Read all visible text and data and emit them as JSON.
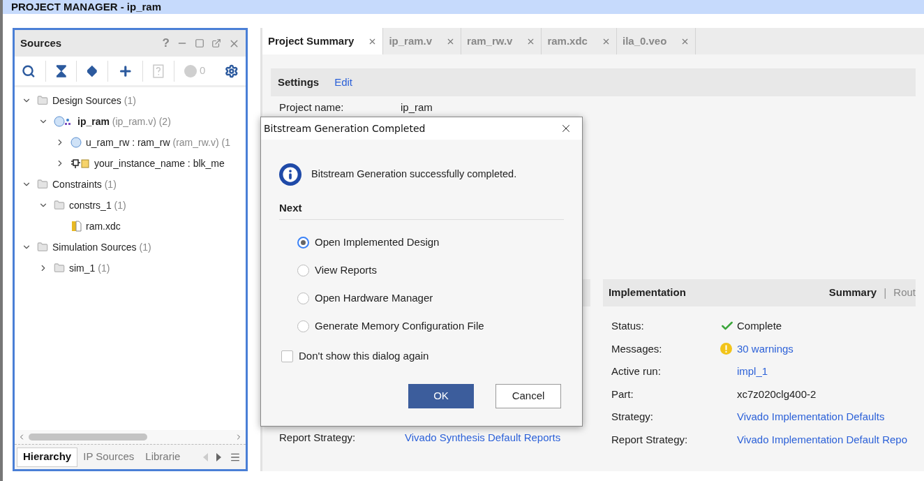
{
  "title_bar": {
    "title": "PROJECT MANAGER - ip_ram"
  },
  "sources": {
    "title": "Sources",
    "help": "?",
    "badge_count": "0",
    "tree": [
      {
        "label": "Design Sources",
        "detail": "(1)",
        "kind": "folder",
        "expanded": true,
        "children": [
          {
            "label": "**ip_ram**",
            "detail": "(ip_ram.v) (2)",
            "kind": "top",
            "expanded": true,
            "children": [
              {
                "label": "u_ram_rw : ram_rw",
                "detail": "(ram_rw.v) (1",
                "kind": "verilog",
                "expanded": false
              },
              {
                "label": "your_instance_name : blk_me",
                "kind": "ip",
                "expanded": false
              }
            ]
          }
        ]
      },
      {
        "label": "Constraints",
        "detail": "(1)",
        "kind": "folder",
        "expanded": true,
        "children": [
          {
            "label": "constrs_1",
            "detail": "(1)",
            "kind": "folder",
            "expanded": true,
            "children": [
              {
                "label": "ram.xdc",
                "kind": "xdc"
              }
            ]
          }
        ]
      },
      {
        "label": "Simulation Sources",
        "detail": "(1)",
        "kind": "folder",
        "expanded": true,
        "children": [
          {
            "label": "sim_1",
            "detail": "(1)",
            "kind": "folder",
            "expanded": false
          }
        ]
      }
    ],
    "bottom_tabs": [
      {
        "label": "Hierarchy",
        "selected": true
      },
      {
        "label": "IP Sources",
        "selected": false
      },
      {
        "label": "Librarie",
        "selected": false
      }
    ]
  },
  "editor_tabs": [
    {
      "label": "Project Summary",
      "selected": true
    },
    {
      "label": "ip_ram.v",
      "selected": false
    },
    {
      "label": "ram_rw.v",
      "selected": false
    },
    {
      "label": "ram.xdc",
      "selected": false
    },
    {
      "label": "ila_0.veo",
      "selected": false
    }
  ],
  "settings": {
    "title": "Settings",
    "edit": "Edit",
    "rows": [
      {
        "label": "Project name:",
        "value": "ip_ram"
      }
    ]
  },
  "synthesis": {
    "rows": [
      {
        "label": "Report Strategy:",
        "value": "Vivado Synthesis Default Reports",
        "kind": "link"
      }
    ]
  },
  "implementation": {
    "title": "Implementation",
    "views": [
      {
        "label": "Summary",
        "selected": true
      },
      {
        "label": "Rout",
        "selected": false
      }
    ],
    "separator": "|",
    "rows": [
      {
        "label": "Status:",
        "value": "Complete",
        "kind": "ok"
      },
      {
        "label": "Messages:",
        "value": "30 warnings",
        "kind": "warning"
      },
      {
        "label": "Active run:",
        "value": "impl_1",
        "kind": "link"
      },
      {
        "label": "Part:",
        "value": "xc7z020clg400-2",
        "kind": "plain"
      },
      {
        "label": "Strategy:",
        "value": "Vivado Implementation Defaults",
        "kind": "link"
      },
      {
        "label": "Report Strategy:",
        "value": "Vivado Implementation Default Repo",
        "kind": "link"
      }
    ]
  },
  "dialog": {
    "title": "Bitstream Generation Completed",
    "message": "Bitstream Generation successfully completed.",
    "section": "Next",
    "options": [
      {
        "label": "Open Implemented Design",
        "selected": true
      },
      {
        "label": "View Reports",
        "selected": false
      },
      {
        "label": "Open Hardware Manager",
        "selected": false
      },
      {
        "label": "Generate Memory Configuration File",
        "selected": false
      }
    ],
    "dont_show": {
      "label": "Don't show this dialog again",
      "checked": false
    },
    "buttons": [
      {
        "label": "OK",
        "kind": "primary"
      },
      {
        "label": "Cancel",
        "kind": "secondary"
      }
    ]
  }
}
